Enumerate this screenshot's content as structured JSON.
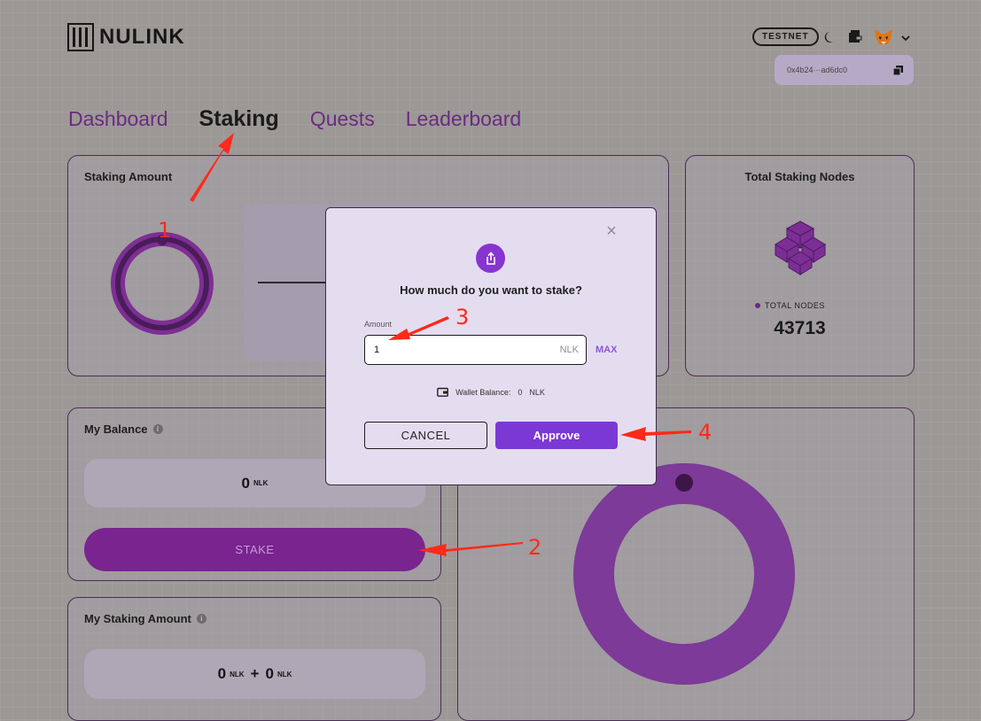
{
  "header": {
    "logo_text": "NULINK",
    "network_badge": "TESTNET",
    "wallet_address": "0x4b24···ad6dc0",
    "icons": [
      "logo-icon",
      "moon-icon",
      "wallet-icon",
      "metamask-fox-icon",
      "chevron-down-icon",
      "copy-icon"
    ]
  },
  "nav": {
    "items": [
      {
        "label": "Dashboard",
        "active": false
      },
      {
        "label": "Staking",
        "active": true
      },
      {
        "label": "Quests",
        "active": false
      },
      {
        "label": "Leaderboard",
        "active": false
      }
    ]
  },
  "staking_amount": {
    "title": "Staking Amount"
  },
  "total_nodes": {
    "title": "Total Staking Nodes",
    "legend_label": "TOTAL NODES",
    "value": "43713"
  },
  "my_balance": {
    "title": "My Balance",
    "value": "0",
    "unit": "NLK",
    "stake_label": "STAKE"
  },
  "my_staking": {
    "title": "My Staking Amount",
    "value_a": "0",
    "unit_a": "NLK",
    "plus": "+",
    "value_b": "0",
    "unit_b": "NLK"
  },
  "modal": {
    "question": "How much do you want to stake?",
    "amount_label": "Amount",
    "amount_value": "1",
    "amount_unit": "NLK",
    "max_label": "MAX",
    "wallet_balance_label": "Wallet Balance:",
    "wallet_balance_value": "0",
    "wallet_balance_unit": "NLK",
    "cancel_label": "CANCEL",
    "approve_label": "Approve",
    "close_glyph": "×"
  },
  "annotations": {
    "n1": "1",
    "n2": "2",
    "n3": "3",
    "n4": "4"
  },
  "colors": {
    "accent": "#7c38d4",
    "brand_purple": "#7a2490",
    "annotation": "#ff2a1a"
  }
}
